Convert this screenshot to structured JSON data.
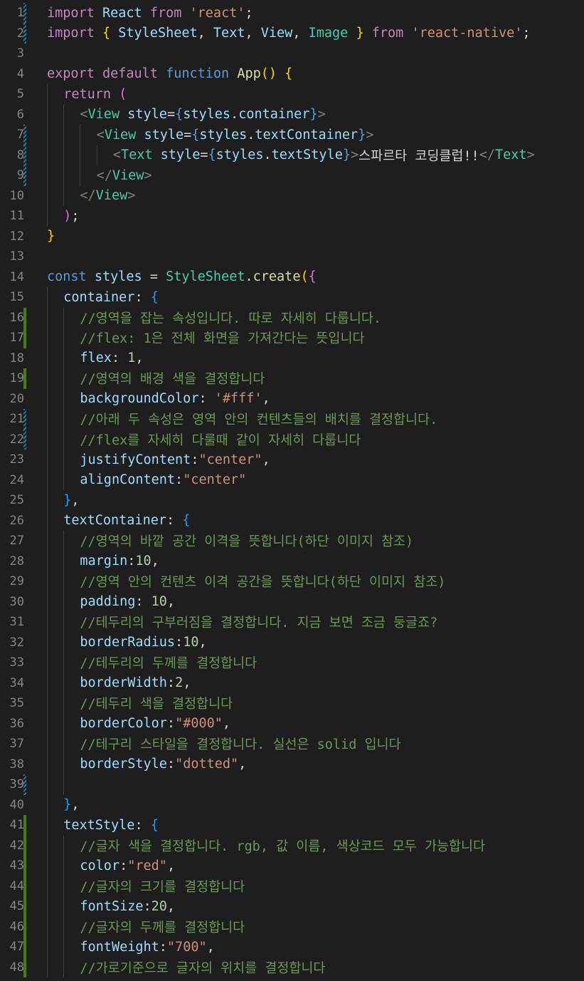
{
  "editor": {
    "language": "javascript",
    "theme_background": "#1e1e1e",
    "lines": [
      {
        "n": "1",
        "mark": "modified",
        "indent": 0,
        "tokens": [
          [
            "kw",
            "import"
          ],
          [
            "pl",
            " "
          ],
          [
            "var",
            "React"
          ],
          [
            "pl",
            " "
          ],
          [
            "kw",
            "from"
          ],
          [
            "pl",
            " "
          ],
          [
            "str",
            "'react'"
          ],
          [
            "pl",
            ";"
          ]
        ]
      },
      {
        "n": "2",
        "mark": "modified",
        "indent": 0,
        "tokens": [
          [
            "kw",
            "import"
          ],
          [
            "pl",
            " "
          ],
          [
            "b1",
            "{"
          ],
          [
            "pl",
            " "
          ],
          [
            "var",
            "StyleSheet"
          ],
          [
            "pl",
            ", "
          ],
          [
            "var",
            "Text"
          ],
          [
            "pl",
            ", "
          ],
          [
            "var",
            "View"
          ],
          [
            "pl",
            ", "
          ],
          [
            "cls",
            "Image"
          ],
          [
            "pl",
            " "
          ],
          [
            "b1",
            "}"
          ],
          [
            "pl",
            " "
          ],
          [
            "kw",
            "from"
          ],
          [
            "pl",
            " "
          ],
          [
            "str",
            "'react-native'"
          ],
          [
            "pl",
            ";"
          ]
        ]
      },
      {
        "n": "3",
        "mark": "",
        "indent": 0,
        "tokens": []
      },
      {
        "n": "4",
        "mark": "",
        "indent": 0,
        "tokens": [
          [
            "kw",
            "export"
          ],
          [
            "pl",
            " "
          ],
          [
            "kw",
            "default"
          ],
          [
            "pl",
            " "
          ],
          [
            "st",
            "function"
          ],
          [
            "pl",
            " "
          ],
          [
            "fn",
            "App"
          ],
          [
            "b1",
            "()"
          ],
          [
            "pl",
            " "
          ],
          [
            "b1",
            "{"
          ]
        ]
      },
      {
        "n": "5",
        "mark": "",
        "indent": 1,
        "tokens": [
          [
            "kw",
            "return"
          ],
          [
            "pl",
            " "
          ],
          [
            "b2",
            "("
          ]
        ]
      },
      {
        "n": "6",
        "mark": "",
        "indent": 2,
        "tokens": [
          [
            "tag",
            "<"
          ],
          [
            "cls",
            "View"
          ],
          [
            "pl",
            " "
          ],
          [
            "var",
            "style"
          ],
          [
            "pl",
            "="
          ],
          [
            "st",
            "{"
          ],
          [
            "var",
            "styles"
          ],
          [
            "pl",
            "."
          ],
          [
            "var",
            "container"
          ],
          [
            "st",
            "}"
          ],
          [
            "tag",
            ">"
          ]
        ]
      },
      {
        "n": "7",
        "mark": "modified",
        "indent": 3,
        "tokens": [
          [
            "tag",
            "<"
          ],
          [
            "cls",
            "View"
          ],
          [
            "pl",
            " "
          ],
          [
            "var",
            "style"
          ],
          [
            "pl",
            "="
          ],
          [
            "st",
            "{"
          ],
          [
            "var",
            "styles"
          ],
          [
            "pl",
            "."
          ],
          [
            "var",
            "textContainer"
          ],
          [
            "st",
            "}"
          ],
          [
            "tag",
            ">"
          ]
        ]
      },
      {
        "n": "8",
        "mark": "modified",
        "indent": 4,
        "tokens": [
          [
            "tag",
            "<"
          ],
          [
            "cls",
            "Text"
          ],
          [
            "pl",
            " "
          ],
          [
            "var",
            "style"
          ],
          [
            "pl",
            "="
          ],
          [
            "st",
            "{"
          ],
          [
            "var",
            "styles"
          ],
          [
            "pl",
            "."
          ],
          [
            "var",
            "textStyle"
          ],
          [
            "st",
            "}"
          ],
          [
            "tag",
            ">"
          ],
          [
            "pl",
            "스파르타 코딩클럽!!"
          ],
          [
            "tag",
            "</"
          ],
          [
            "cls",
            "Text"
          ],
          [
            "tag",
            ">"
          ]
        ]
      },
      {
        "n": "9",
        "mark": "modified",
        "indent": 3,
        "tokens": [
          [
            "tag",
            "</"
          ],
          [
            "cls",
            "View"
          ],
          [
            "tag",
            ">"
          ]
        ]
      },
      {
        "n": "10",
        "mark": "",
        "indent": 2,
        "tokens": [
          [
            "tag",
            "</"
          ],
          [
            "cls",
            "View"
          ],
          [
            "tag",
            ">"
          ]
        ]
      },
      {
        "n": "11",
        "mark": "",
        "indent": 1,
        "tokens": [
          [
            "b2",
            ")"
          ],
          [
            "pl",
            ";"
          ]
        ]
      },
      {
        "n": "12",
        "mark": "",
        "indent": 0,
        "tokens": [
          [
            "b1",
            "}"
          ]
        ]
      },
      {
        "n": "13",
        "mark": "",
        "indent": 0,
        "tokens": []
      },
      {
        "n": "14",
        "mark": "",
        "indent": 0,
        "tokens": [
          [
            "st",
            "const"
          ],
          [
            "pl",
            " "
          ],
          [
            "var",
            "styles"
          ],
          [
            "pl",
            " = "
          ],
          [
            "cls",
            "StyleSheet"
          ],
          [
            "pl",
            "."
          ],
          [
            "fn",
            "create"
          ],
          [
            "b1",
            "("
          ],
          [
            "b2",
            "{"
          ]
        ]
      },
      {
        "n": "15",
        "mark": "",
        "indent": 1,
        "tokens": [
          [
            "var",
            "container"
          ],
          [
            "pl",
            ": "
          ],
          [
            "b3",
            "{"
          ]
        ]
      },
      {
        "n": "16",
        "mark": "added",
        "indent": 2,
        "tokens": [
          [
            "cm",
            "//영역을 잡는 속성입니다. 따로 자세히 다룹니다."
          ]
        ]
      },
      {
        "n": "17",
        "mark": "added",
        "indent": 2,
        "tokens": [
          [
            "cm",
            "//flex: 1은 전체 화면을 가져간다는 뜻입니다"
          ]
        ]
      },
      {
        "n": "18",
        "mark": "",
        "indent": 2,
        "tokens": [
          [
            "var",
            "flex"
          ],
          [
            "pl",
            ": "
          ],
          [
            "num",
            "1"
          ],
          [
            "pl",
            ","
          ]
        ]
      },
      {
        "n": "19",
        "mark": "added",
        "indent": 2,
        "tokens": [
          [
            "cm",
            "//영역의 배경 색을 결정합니다"
          ]
        ]
      },
      {
        "n": "20",
        "mark": "",
        "indent": 2,
        "tokens": [
          [
            "var",
            "backgroundColor"
          ],
          [
            "pl",
            ": "
          ],
          [
            "str",
            "'#fff'"
          ],
          [
            "pl",
            ","
          ]
        ]
      },
      {
        "n": "21",
        "mark": "modified",
        "indent": 2,
        "tokens": [
          [
            "cm",
            "//아래 두 속성은 영역 안의 컨텐츠들의 배치를 결정합니다."
          ]
        ]
      },
      {
        "n": "22",
        "mark": "modified",
        "indent": 2,
        "tokens": [
          [
            "cm",
            "//flex를 자세히 다룰때 같이 자세히 다룹니다"
          ]
        ]
      },
      {
        "n": "23",
        "mark": "",
        "indent": 2,
        "tokens": [
          [
            "var",
            "justifyContent"
          ],
          [
            "pl",
            ":"
          ],
          [
            "str",
            "\"center\""
          ],
          [
            "pl",
            ","
          ]
        ]
      },
      {
        "n": "24",
        "mark": "",
        "indent": 2,
        "tokens": [
          [
            "var",
            "alignContent"
          ],
          [
            "pl",
            ":"
          ],
          [
            "str",
            "\"center\""
          ]
        ]
      },
      {
        "n": "25",
        "mark": "",
        "indent": 1,
        "tokens": [
          [
            "b3",
            "}"
          ],
          [
            "pl",
            ","
          ]
        ]
      },
      {
        "n": "26",
        "mark": "",
        "indent": 1,
        "tokens": [
          [
            "var",
            "textContainer"
          ],
          [
            "pl",
            ": "
          ],
          [
            "b3",
            "{"
          ]
        ]
      },
      {
        "n": "27",
        "mark": "",
        "indent": 2,
        "tokens": [
          [
            "cm",
            "//영역의 바깥 공간 이격을 뜻합니다(하단 이미지 참조)"
          ]
        ]
      },
      {
        "n": "28",
        "mark": "",
        "indent": 2,
        "tokens": [
          [
            "var",
            "margin"
          ],
          [
            "pl",
            ":"
          ],
          [
            "num",
            "10"
          ],
          [
            "pl",
            ","
          ]
        ]
      },
      {
        "n": "29",
        "mark": "",
        "indent": 2,
        "tokens": [
          [
            "cm",
            "//영역 안의 컨텐츠 이격 공간을 뜻합니다(하단 이미지 참조)"
          ]
        ]
      },
      {
        "n": "30",
        "mark": "",
        "indent": 2,
        "tokens": [
          [
            "var",
            "padding"
          ],
          [
            "pl",
            ": "
          ],
          [
            "num",
            "10"
          ],
          [
            "pl",
            ","
          ]
        ]
      },
      {
        "n": "31",
        "mark": "",
        "indent": 2,
        "tokens": [
          [
            "cm",
            "//테두리의 구부러짐을 결정합니다. 지금 보면 조금 둥글죠?"
          ]
        ]
      },
      {
        "n": "32",
        "mark": "",
        "indent": 2,
        "tokens": [
          [
            "var",
            "borderRadius"
          ],
          [
            "pl",
            ":"
          ],
          [
            "num",
            "10"
          ],
          [
            "pl",
            ","
          ]
        ]
      },
      {
        "n": "33",
        "mark": "",
        "indent": 2,
        "tokens": [
          [
            "cm",
            "//테두리의 두께를 결정합니다"
          ]
        ]
      },
      {
        "n": "34",
        "mark": "",
        "indent": 2,
        "tokens": [
          [
            "var",
            "borderWidth"
          ],
          [
            "pl",
            ":"
          ],
          [
            "num",
            "2"
          ],
          [
            "pl",
            ","
          ]
        ]
      },
      {
        "n": "35",
        "mark": "",
        "indent": 2,
        "tokens": [
          [
            "cm",
            "//테두리 색을 결정합니다"
          ]
        ]
      },
      {
        "n": "36",
        "mark": "",
        "indent": 2,
        "tokens": [
          [
            "var",
            "borderColor"
          ],
          [
            "pl",
            ":"
          ],
          [
            "str",
            "\"#000\""
          ],
          [
            "pl",
            ","
          ]
        ]
      },
      {
        "n": "37",
        "mark": "",
        "indent": 2,
        "tokens": [
          [
            "cm",
            "//테구리 스타일을 결정합니다. 실선은 solid 입니다"
          ]
        ]
      },
      {
        "n": "38",
        "mark": "",
        "indent": 2,
        "tokens": [
          [
            "var",
            "borderStyle"
          ],
          [
            "pl",
            ":"
          ],
          [
            "str",
            "\"dotted\""
          ],
          [
            "pl",
            ","
          ]
        ]
      },
      {
        "n": "39",
        "mark": "modified",
        "indent": 2,
        "tokens": []
      },
      {
        "n": "40",
        "mark": "",
        "indent": 1,
        "tokens": [
          [
            "b3",
            "}"
          ],
          [
            "pl",
            ","
          ]
        ]
      },
      {
        "n": "41",
        "mark": "added",
        "indent": 1,
        "tokens": [
          [
            "var",
            "textStyle"
          ],
          [
            "pl",
            ": "
          ],
          [
            "b3",
            "{"
          ]
        ]
      },
      {
        "n": "42",
        "mark": "added",
        "indent": 2,
        "tokens": [
          [
            "cm",
            "//글자 색을 결정합니다. rgb, 값 이름, 색상코드 모두 가능합니다"
          ]
        ]
      },
      {
        "n": "43",
        "mark": "added",
        "indent": 2,
        "tokens": [
          [
            "var",
            "color"
          ],
          [
            "pl",
            ":"
          ],
          [
            "str",
            "\"red\""
          ],
          [
            "pl",
            ","
          ]
        ]
      },
      {
        "n": "44",
        "mark": "added",
        "indent": 2,
        "tokens": [
          [
            "cm",
            "//글자의 크기를 결정합니다"
          ]
        ]
      },
      {
        "n": "45",
        "mark": "added",
        "indent": 2,
        "tokens": [
          [
            "var",
            "fontSize"
          ],
          [
            "pl",
            ":"
          ],
          [
            "num",
            "20"
          ],
          [
            "pl",
            ","
          ]
        ]
      },
      {
        "n": "46",
        "mark": "added",
        "indent": 2,
        "tokens": [
          [
            "cm",
            "//글자의 두께를 결정합니다"
          ]
        ]
      },
      {
        "n": "47",
        "mark": "added",
        "indent": 2,
        "tokens": [
          [
            "var",
            "fontWeight"
          ],
          [
            "pl",
            ":"
          ],
          [
            "str",
            "\"700\""
          ],
          [
            "pl",
            ","
          ]
        ]
      },
      {
        "n": "48",
        "mark": "added",
        "indent": 2,
        "tokens": [
          [
            "cm",
            "//가로기준으로 글자의 위치를 결정합니다"
          ]
        ]
      }
    ]
  }
}
